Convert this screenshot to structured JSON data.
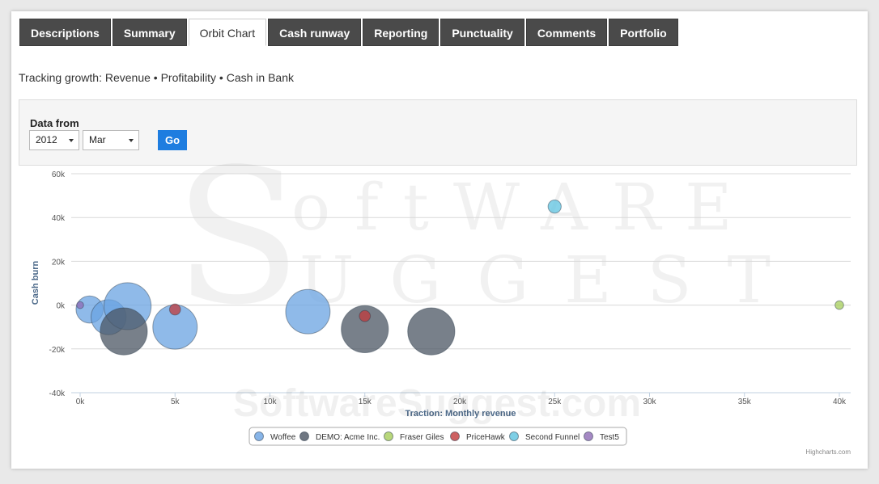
{
  "tabs": [
    "Descriptions",
    "Summary",
    "Orbit Chart",
    "Cash runway",
    "Reporting",
    "Punctuality",
    "Comments",
    "Portfolio"
  ],
  "subtitle": "Tracking growth: Revenue • Profitability • Cash in Bank",
  "filter": {
    "label": "Data from",
    "year": "2012",
    "month": "Mar",
    "go_label": "Go"
  },
  "credit": "Highcharts.com",
  "watermark": "SoftwareSuggest.com",
  "colors": {
    "grid": "#d8d8d8",
    "axis_title": "#4d6a8a",
    "tick": "#555555"
  },
  "chart_data": {
    "type": "scatter",
    "subtype": "bubble",
    "xlabel": "Traction: Monthly revenue",
    "ylabel": "Cash burn",
    "xlim": [
      0,
      40000
    ],
    "ylim": [
      -40000,
      60000
    ],
    "x_ticks": [
      "0k",
      "5k",
      "10k",
      "15k",
      "20k",
      "25k",
      "30k",
      "35k",
      "40k"
    ],
    "y_ticks": [
      "60k",
      "40k",
      "20k",
      "0k",
      "-20k",
      "-40k"
    ],
    "grid": true,
    "legend_position": "bottom-center",
    "series": [
      {
        "name": "Woffee",
        "color": "#6aa3e2",
        "points": [
          {
            "x": 500,
            "y": -2000,
            "z": 3
          },
          {
            "x": 1500,
            "y": -5500,
            "z": 5
          },
          {
            "x": 2500,
            "y": -500,
            "z": 9
          },
          {
            "x": 5000,
            "y": -10000,
            "z": 8
          },
          {
            "x": 12000,
            "y": -3000,
            "z": 8
          }
        ]
      },
      {
        "name": "DEMO: Acme Inc.",
        "color": "#4b5563",
        "points": [
          {
            "x": 2300,
            "y": -12000,
            "z": 9
          },
          {
            "x": 15000,
            "y": -11000,
            "z": 9
          },
          {
            "x": 18500,
            "y": -12000,
            "z": 9
          }
        ]
      },
      {
        "name": "Fraser Giles",
        "color": "#a6cd5a",
        "points": [
          {
            "x": 40000,
            "y": 0,
            "z": 0.3
          }
        ]
      },
      {
        "name": "PriceHawk",
        "color": "#c0393b",
        "points": [
          {
            "x": 5000,
            "y": -2000,
            "z": 0.5
          },
          {
            "x": 15000,
            "y": -5000,
            "z": 0.5
          }
        ]
      },
      {
        "name": "Second Funnel",
        "color": "#5ec3e0",
        "points": [
          {
            "x": 25000,
            "y": 45000,
            "z": 0.7
          }
        ]
      },
      {
        "name": "Test5",
        "color": "#8e6bb5",
        "points": [
          {
            "x": 0,
            "y": 0,
            "z": 0.2
          }
        ]
      }
    ]
  }
}
